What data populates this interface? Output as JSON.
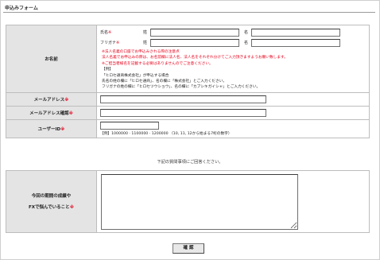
{
  "page": {
    "title": "申込みフォーム"
  },
  "name_section": {
    "label": "お名前",
    "kanji_label": "氏名",
    "kana_label": "フリガナ",
    "req_mark": "※",
    "sei": "姓",
    "mei": "名",
    "notes": [
      {
        "text": "※法人名義の口座でお申込みされる際の注意点",
        "red": true
      },
      {
        "text": "法人名義でお申込みの際は、お名前欄に法人名、法人名をそれぞれ分けてご入力頂きますようお願い致します。",
        "red": true
      },
      {
        "text": "※ご担当者様名を記載する必要はありませんのでご注意ください。",
        "red": true
      },
      {
        "text": "【例】",
        "red": false
      },
      {
        "text": "「ヒロセ通商株式会社」が申込する場合",
        "red": false
      },
      {
        "text": "氏名の姓の欄に「ヒロセ通商」、名の欄に「株式会社」とご入力ください。",
        "red": false
      },
      {
        "text": "フリガナの姓の欄に「ヒロセツウショウ」、名の欄に「カブシキガイシャ」とご入力ください。",
        "red": false
      }
    ]
  },
  "email": {
    "label": "メールアドレス",
    "req_mark": "※",
    "value": ""
  },
  "email_confirm": {
    "label": "メールアドレス確認",
    "req_mark": "※",
    "value": ""
  },
  "user_id": {
    "label": "ユーザーID",
    "req_mark": "※",
    "value": "",
    "example": "【例】1000000 · 1100000 · 1200000 （10, 11, 12から始まる7桁の数字）"
  },
  "survey": {
    "intro": "下記の質問事項にご回答ください。",
    "label_line1": "今回の期間の成績や",
    "label_line2": "FXで悩んでいること",
    "req_mark": "※",
    "value": ""
  },
  "submit": {
    "label": "確 認"
  }
}
